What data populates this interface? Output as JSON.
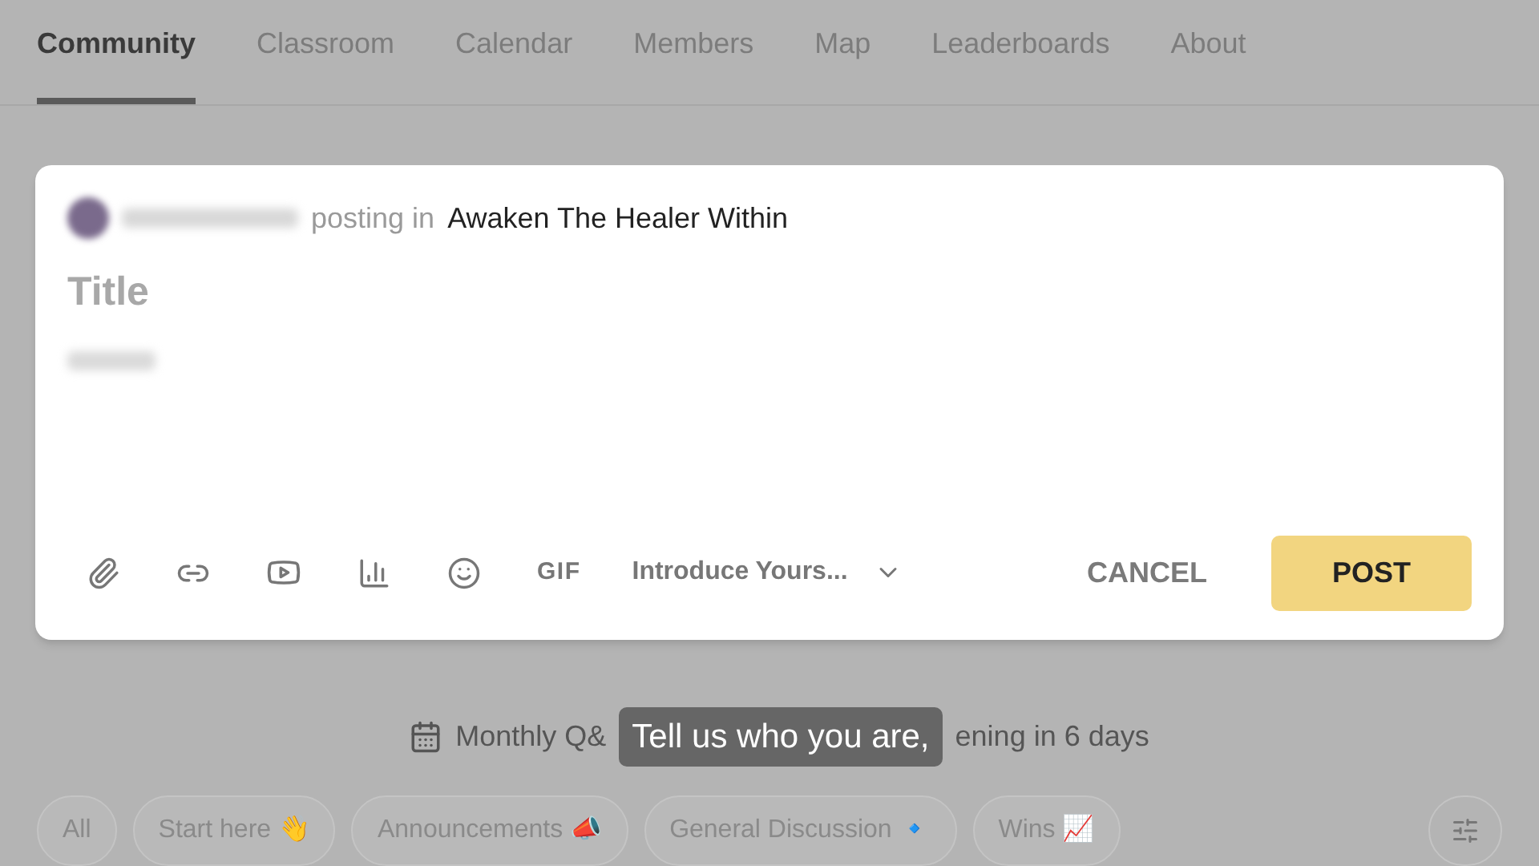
{
  "tabs": [
    {
      "label": "Community",
      "selected": true
    },
    {
      "label": "Classroom",
      "selected": false
    },
    {
      "label": "Calendar",
      "selected": false
    },
    {
      "label": "Members",
      "selected": false
    },
    {
      "label": "Map",
      "selected": false
    },
    {
      "label": "Leaderboards",
      "selected": false
    },
    {
      "label": "About",
      "selected": false
    }
  ],
  "composer": {
    "posting_in_label": "posting in",
    "group_name": "Awaken The Healer Within",
    "title_placeholder": "Title",
    "category": "Introduce Yours...",
    "cancel": "CANCEL",
    "post": "POST",
    "gif": "GIF"
  },
  "event": {
    "text_start": "Monthly Q&",
    "text_end": "ening in 6 days"
  },
  "caption": "Tell us who you are,",
  "filters": [
    {
      "label": "All",
      "selected": false
    },
    {
      "label": "Start here 👋",
      "selected": false
    },
    {
      "label": "Announcements 📣",
      "selected": false
    },
    {
      "label": "General Discussion 🔹",
      "selected": false
    },
    {
      "label": "Wins 📈",
      "selected": false
    }
  ]
}
